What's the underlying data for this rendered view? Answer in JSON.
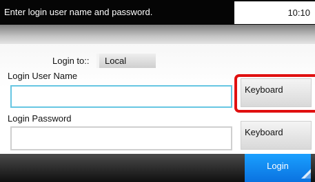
{
  "header": {
    "message": "Enter login user name and password.",
    "time": "10:10"
  },
  "form": {
    "login_to_label": "Login to::",
    "login_to_value": "Local",
    "user_name_label": "Login User Name",
    "user_name_value": "",
    "password_label": "Login Password",
    "password_value": "",
    "keyboard_button_label": "Keyboard",
    "keyboard_button_label_2": "Keyboard"
  },
  "footer": {
    "login_label": "Login"
  },
  "colors": {
    "header_bg": "#050505",
    "login_button": "#0a72e0",
    "highlight": "#e01010",
    "active_field_border": "#66c6e2"
  },
  "icons": {
    "corner": "corner-arrow-icon"
  }
}
